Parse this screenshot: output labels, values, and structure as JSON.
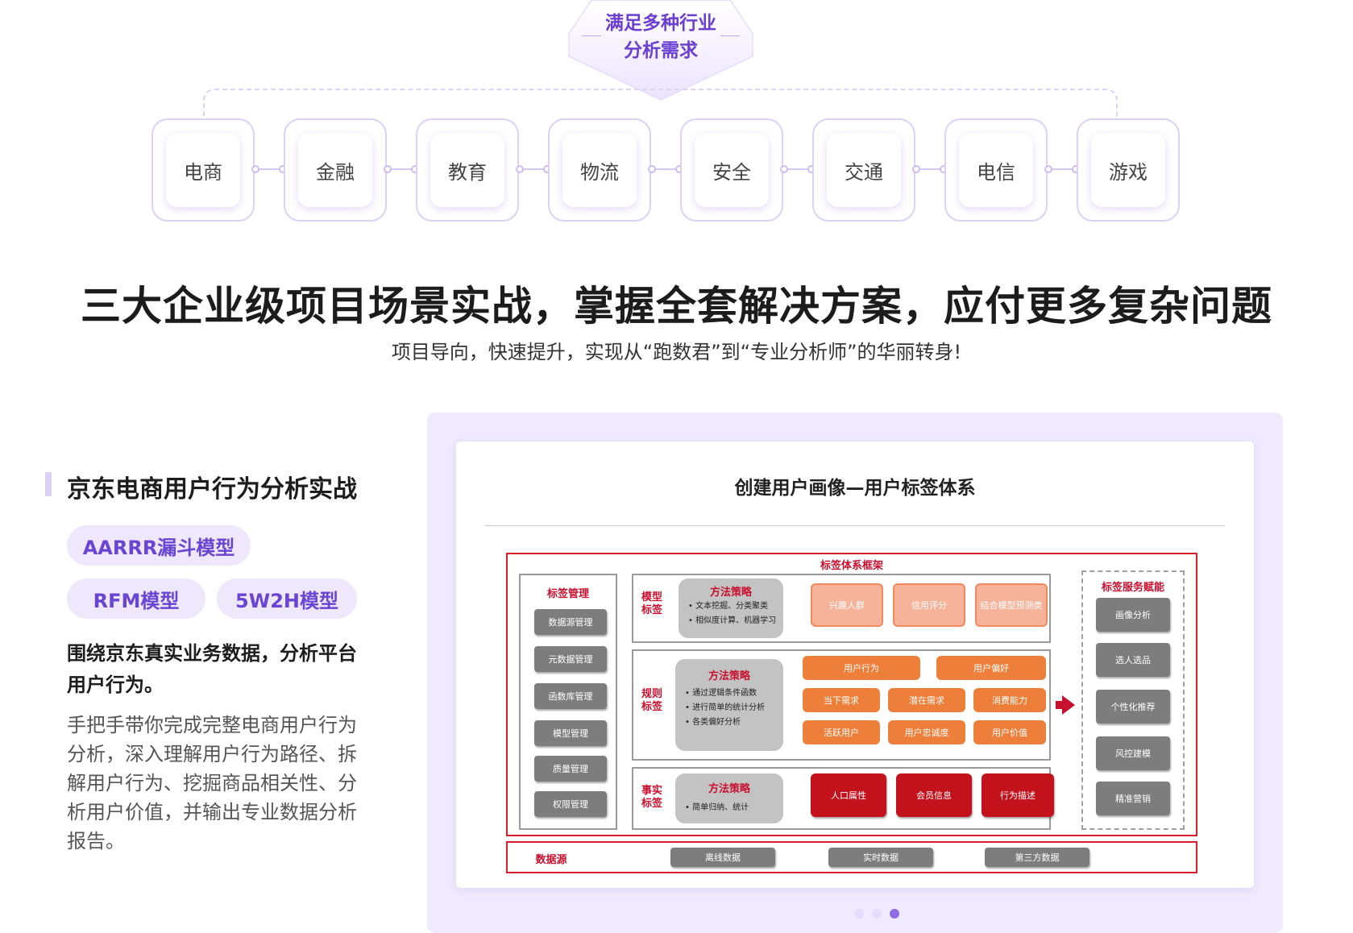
{
  "badge": {
    "line1": "满足多种行业",
    "line2": "分析需求"
  },
  "industries": [
    "电商",
    "金融",
    "教育",
    "物流",
    "安全",
    "交通",
    "电信",
    "游戏"
  ],
  "heading": {
    "title": "三大企业级项目场景实战，掌握全套解决方案，应付更多复杂问题",
    "subtitle": "项目导向，快速提升，实现从“跑数君”到“专业分析师”的华丽转身!"
  },
  "project": {
    "title": "京东电商用户行为分析实战",
    "models": [
      "AARRR漏斗模型",
      "RFM模型",
      "5W2H模型"
    ],
    "lead": "围绕京东真实业务数据，分析平台用户行为。",
    "description": "手把手带你完成完整电商用户行为分析，深入理解用户行为路径、拆解用户行为、挖掘商品相关性、分析用户价值，并输出专业数据分析报告。"
  },
  "slide": {
    "title": "创建用户画像—用户标签体系",
    "framework_label": "标签体系框架",
    "management": {
      "title": "标签管理",
      "items": [
        "数据源管理",
        "元数据管理",
        "函数库管理",
        "模型管理",
        "质量管理",
        "权限管理"
      ]
    },
    "model_tags": {
      "label_line1": "模型",
      "label_line2": "标签",
      "method_title": "方法策略",
      "methods": [
        "文本挖掘、分类聚类",
        "相似度计算、机器学习"
      ],
      "tags": [
        "兴趣人群",
        "信用评分",
        "结合模型预测类"
      ]
    },
    "rule_tags": {
      "label_line1": "规则",
      "label_line2": "标签",
      "method_title": "方法策略",
      "methods": [
        "通过逻辑条件函数",
        "进行简单的统计分析",
        "各类偏好分析"
      ],
      "tags_row1": [
        "用户行为",
        "用户偏好"
      ],
      "tags_row2": [
        "当下需求",
        "潜在需求",
        "消费能力"
      ],
      "tags_row3": [
        "活跃用户",
        "用户忠诚度",
        "用户价值"
      ]
    },
    "fact_tags": {
      "label_line1": "事实",
      "label_line2": "标签",
      "method_title": "方法策略",
      "methods": [
        "简单归纳、统计"
      ],
      "tags": [
        "人口属性",
        "会员信息",
        "行为描述"
      ]
    },
    "service": {
      "title": "标签服务赋能",
      "items": [
        "画像分析",
        "选人选品",
        "个性化推荐",
        "风控建模",
        "精准营销"
      ]
    },
    "datasource": {
      "label": "数据源",
      "items": [
        "离线数据",
        "实时数据",
        "第三方数据"
      ]
    }
  },
  "colors": {
    "accent_purple": "#6a44d3",
    "pill_bg": "#efe8fd",
    "diagram_red": "#c8102e",
    "tag_orange": "#ee7f3a"
  }
}
